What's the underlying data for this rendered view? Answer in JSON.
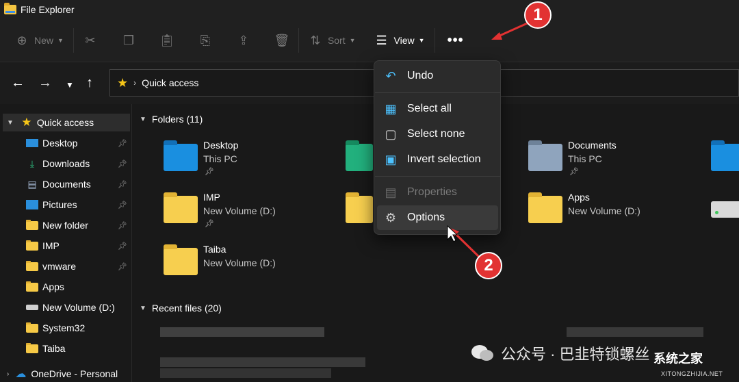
{
  "window": {
    "title": "File Explorer"
  },
  "toolbar": {
    "new_label": "New",
    "sort_label": "Sort",
    "view_label": "View",
    "more_label": "•••"
  },
  "address": {
    "breadcrumb": "Quick access"
  },
  "sidebar": {
    "items": [
      {
        "label": "Quick access"
      },
      {
        "label": "Desktop"
      },
      {
        "label": "Downloads"
      },
      {
        "label": "Documents"
      },
      {
        "label": "Pictures"
      },
      {
        "label": "New folder"
      },
      {
        "label": "IMP"
      },
      {
        "label": "vmware"
      },
      {
        "label": "Apps"
      },
      {
        "label": "New Volume (D:)"
      },
      {
        "label": "System32"
      },
      {
        "label": "Taiba"
      },
      {
        "label": "OneDrive - Personal"
      }
    ]
  },
  "content": {
    "folders_header": "Folders (11)",
    "recent_header": "Recent files (20)",
    "tiles": [
      {
        "name": "Desktop",
        "location": "This PC"
      },
      {
        "name": "Documents",
        "location": "This PC"
      },
      {
        "name": "IMP",
        "location": "New Volume (D:)"
      },
      {
        "name": "Apps",
        "location": "New Volume (D:)"
      },
      {
        "name": "Taiba",
        "location": "New Volume (D:)"
      }
    ]
  },
  "menu": {
    "items": [
      {
        "label": "Undo"
      },
      {
        "label": "Select all"
      },
      {
        "label": "Select none"
      },
      {
        "label": "Invert selection"
      },
      {
        "label": "Properties"
      },
      {
        "label": "Options"
      }
    ]
  },
  "callouts": {
    "one": "1",
    "two": "2"
  },
  "watermark": {
    "text": "公众号 · 巴韭特锁螺丝",
    "logo": "系统之家",
    "url": "XITONGZHIJIA.NET"
  },
  "colors": {
    "accent": "#4cc2ff",
    "badge": "#e23232",
    "folder": "#f7cf4f"
  }
}
